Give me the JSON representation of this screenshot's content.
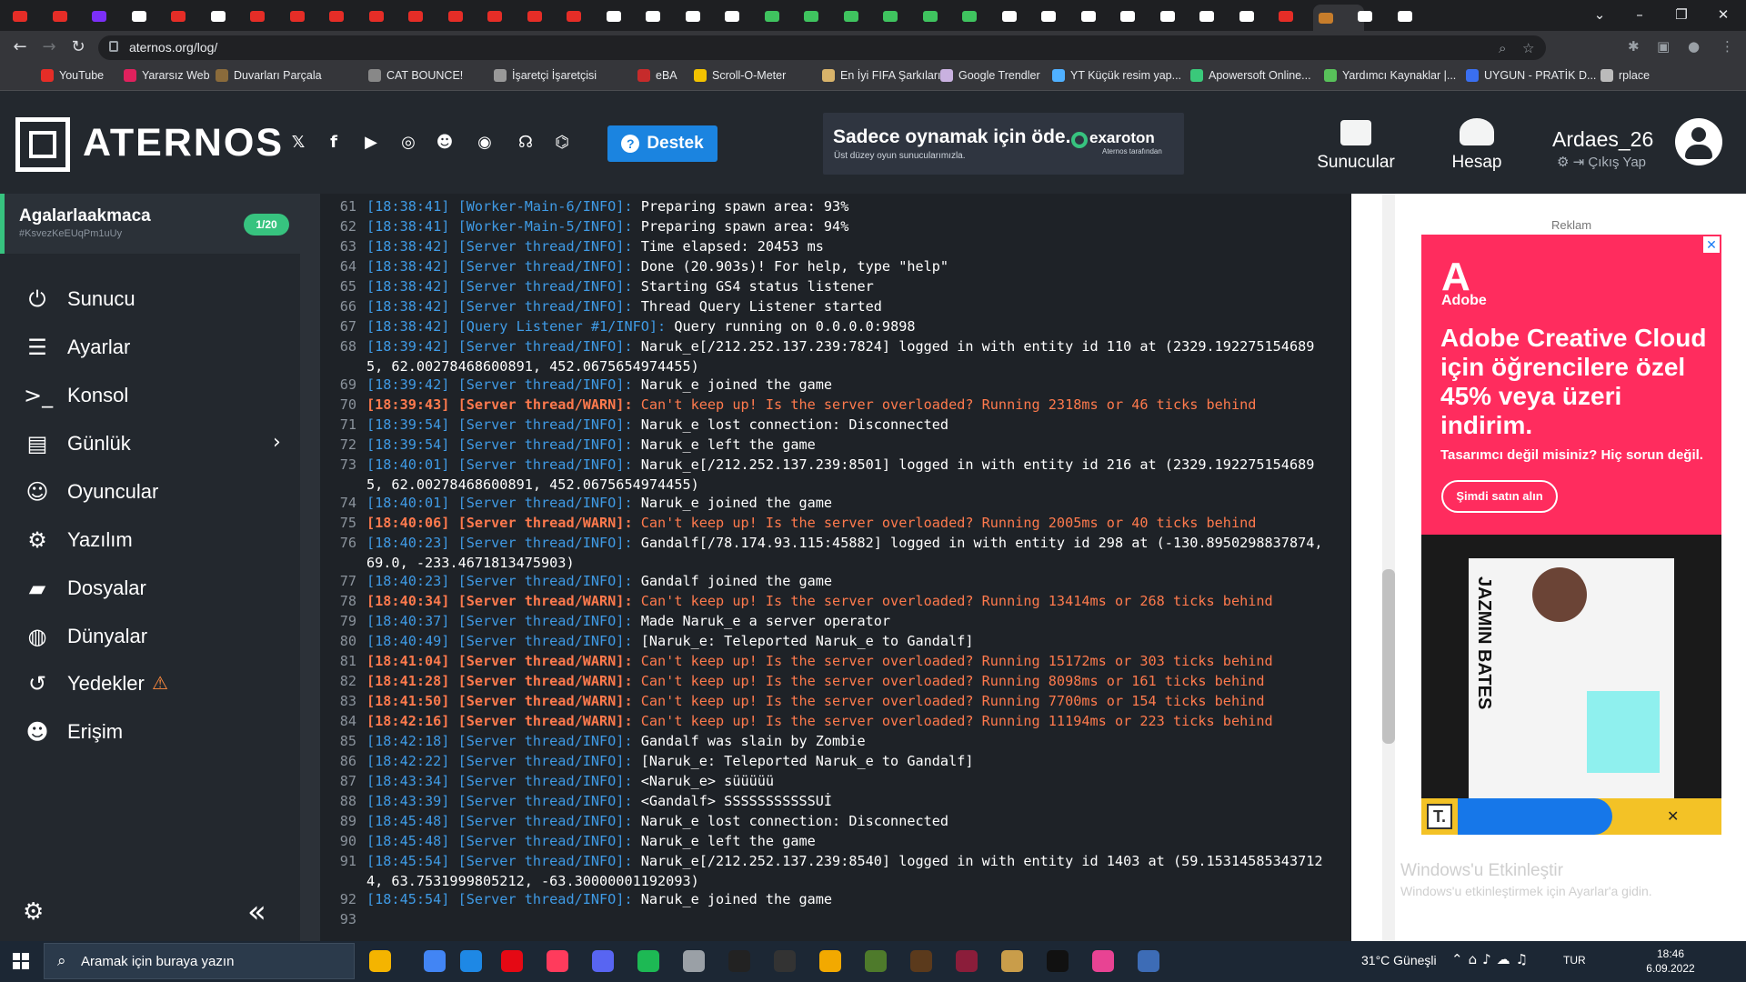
{
  "browser": {
    "url": "aternos.org/log/",
    "bookmarks": [
      "YouTube",
      "Yararsız Web",
      "Duvarları Parçala",
      "CAT BOUNCE!",
      "İşaretçi İşaretçisi",
      "eBA",
      "Scroll-O-Meter",
      "En İyi FIFA Şarkıları...",
      "Google Trendler",
      "YT Küçük resim yap...",
      "Apowersoft Online...",
      "Yardımcı Kaynaklar |...",
      "UYGUN - PRATİK D...",
      "rplace"
    ],
    "tabs_count": 36
  },
  "header": {
    "logo": "ATERNOS",
    "support_label": "Destek",
    "ad_headline": "Sadece oynamak için öde.",
    "ad_sub": "Üst düzey oyun sunucularımızla.",
    "ad_brand": "exaroton",
    "ad_brand_sub": "Aternos tarafından",
    "nav_servers": "Sunucular",
    "nav_account": "Hesap",
    "username": "Ardaes_26",
    "logout": "Çıkış Yap"
  },
  "sidebar": {
    "server_name": "Agalarlaakmaca",
    "server_id": "#KsvezKeEUqPm1uUy",
    "player_count": "1/20",
    "items": [
      {
        "label": "Sunucu"
      },
      {
        "label": "Ayarlar"
      },
      {
        "label": "Konsol"
      },
      {
        "label": "Günlük"
      },
      {
        "label": "Oyuncular"
      },
      {
        "label": "Yazılım"
      },
      {
        "label": "Dosyalar"
      },
      {
        "label": "Dünyalar"
      },
      {
        "label": "Yedekler"
      },
      {
        "label": "Erişim"
      }
    ]
  },
  "log": [
    {
      "n": "61",
      "t": "[18:38:41]",
      "s": "[Worker-Main-6/INFO]:",
      "m": "Preparing spawn area: 93%",
      "w": false
    },
    {
      "n": "62",
      "t": "[18:38:41]",
      "s": "[Worker-Main-5/INFO]:",
      "m": "Preparing spawn area: 94%",
      "w": false
    },
    {
      "n": "63",
      "t": "[18:38:42]",
      "s": "[Server thread/INFO]:",
      "m": "Time elapsed: 20453 ms",
      "w": false
    },
    {
      "n": "64",
      "t": "[18:38:42]",
      "s": "[Server thread/INFO]:",
      "m": "Done (20.903s)! For help, type \"help\"",
      "w": false
    },
    {
      "n": "65",
      "t": "[18:38:42]",
      "s": "[Server thread/INFO]:",
      "m": "Starting GS4 status listener",
      "w": false
    },
    {
      "n": "66",
      "t": "[18:38:42]",
      "s": "[Server thread/INFO]:",
      "m": "Thread Query Listener started",
      "w": false
    },
    {
      "n": "67",
      "t": "[18:38:42]",
      "s": "[Query Listener #1/INFO]:",
      "m": "Query running on 0.0.0.0:9898",
      "w": false
    },
    {
      "n": "68",
      "t": "[18:39:42]",
      "s": "[Server thread/INFO]:",
      "m": "Naruk_e[/212.252.137.239:7824] logged in with entity id 110 at (2329.192275154689",
      "m2": "5, 62.00278468600891, 452.0675654974455)",
      "w": false
    },
    {
      "n": "69",
      "t": "[18:39:42]",
      "s": "[Server thread/INFO]:",
      "m": "Naruk_e joined the game",
      "w": false
    },
    {
      "n": "70",
      "t": "[18:39:43]",
      "s": "[Server thread/WARN]:",
      "m": "Can't keep up! Is the server overloaded? Running 2318ms or 46 ticks behind",
      "w": true
    },
    {
      "n": "71",
      "t": "[18:39:54]",
      "s": "[Server thread/INFO]:",
      "m": "Naruk_e lost connection: Disconnected",
      "w": false
    },
    {
      "n": "72",
      "t": "[18:39:54]",
      "s": "[Server thread/INFO]:",
      "m": "Naruk_e left the game",
      "w": false
    },
    {
      "n": "73",
      "t": "[18:40:01]",
      "s": "[Server thread/INFO]:",
      "m": "Naruk_e[/212.252.137.239:8501] logged in with entity id 216 at (2329.192275154689",
      "m2": "5, 62.00278468600891, 452.0675654974455)",
      "w": false
    },
    {
      "n": "74",
      "t": "[18:40:01]",
      "s": "[Server thread/INFO]:",
      "m": "Naruk_e joined the game",
      "w": false
    },
    {
      "n": "75",
      "t": "[18:40:06]",
      "s": "[Server thread/WARN]:",
      "m": "Can't keep up! Is the server overloaded? Running 2005ms or 40 ticks behind",
      "w": true
    },
    {
      "n": "76",
      "t": "[18:40:23]",
      "s": "[Server thread/INFO]:",
      "m": "Gandalf[/78.174.93.115:45882] logged in with entity id 298 at (-130.8950298837874,",
      "m2": "69.0, -233.4671813475903)",
      "w": false
    },
    {
      "n": "77",
      "t": "[18:40:23]",
      "s": "[Server thread/INFO]:",
      "m": "Gandalf joined the game",
      "w": false
    },
    {
      "n": "78",
      "t": "[18:40:34]",
      "s": "[Server thread/WARN]:",
      "m": "Can't keep up! Is the server overloaded? Running 13414ms or 268 ticks behind",
      "w": true
    },
    {
      "n": "79",
      "t": "[18:40:37]",
      "s": "[Server thread/INFO]:",
      "m": "Made Naruk_e a server operator",
      "w": false
    },
    {
      "n": "80",
      "t": "[18:40:49]",
      "s": "[Server thread/INFO]:",
      "m": "[Naruk_e: Teleported Naruk_e to Gandalf]",
      "w": false
    },
    {
      "n": "81",
      "t": "[18:41:04]",
      "s": "[Server thread/WARN]:",
      "m": "Can't keep up! Is the server overloaded? Running 15172ms or 303 ticks behind",
      "w": true
    },
    {
      "n": "82",
      "t": "[18:41:28]",
      "s": "[Server thread/WARN]:",
      "m": "Can't keep up! Is the server overloaded? Running 8098ms or 161 ticks behind",
      "w": true
    },
    {
      "n": "83",
      "t": "[18:41:50]",
      "s": "[Server thread/WARN]:",
      "m": "Can't keep up! Is the server overloaded? Running 7700ms or 154 ticks behind",
      "w": true
    },
    {
      "n": "84",
      "t": "[18:42:16]",
      "s": "[Server thread/WARN]:",
      "m": "Can't keep up! Is the server overloaded? Running 11194ms or 223 ticks behind",
      "w": true
    },
    {
      "n": "85",
      "t": "[18:42:18]",
      "s": "[Server thread/INFO]:",
      "m": "Gandalf was slain by Zombie",
      "w": false
    },
    {
      "n": "86",
      "t": "[18:42:22]",
      "s": "[Server thread/INFO]:",
      "m": "[Naruk_e: Teleported Naruk_e to Gandalf]",
      "w": false
    },
    {
      "n": "87",
      "t": "[18:43:34]",
      "s": "[Server thread/INFO]:",
      "m": "<Naruk_e> süüüüü",
      "w": false
    },
    {
      "n": "88",
      "t": "[18:43:39]",
      "s": "[Server thread/INFO]:",
      "m": "<Gandalf> SSSSSSSSSSSUİ",
      "w": false
    },
    {
      "n": "89",
      "t": "[18:45:48]",
      "s": "[Server thread/INFO]:",
      "m": "Naruk_e lost connection: Disconnected",
      "w": false
    },
    {
      "n": "90",
      "t": "[18:45:48]",
      "s": "[Server thread/INFO]:",
      "m": "Naruk_e left the game",
      "w": false
    },
    {
      "n": "91",
      "t": "[18:45:54]",
      "s": "[Server thread/INFO]:",
      "m": "Naruk_e[/212.252.137.239:8540] logged in with entity id 1403 at (59.15314585343712",
      "m2": "4, 63.7531999805212, -63.30000001192093)",
      "w": false
    },
    {
      "n": "92",
      "t": "[18:45:54]",
      "s": "[Server thread/INFO]:",
      "m": "Naruk_e joined the game",
      "w": false
    },
    {
      "n": "93",
      "t": "",
      "s": "",
      "m": "",
      "w": false
    }
  ],
  "ad": {
    "label": "Reklam",
    "brand": "Adobe",
    "headline": "Adobe Creative Cloud için öğrencilere özel 45% veya üzeri indirim.",
    "sub": "Tasarımcı değil misiniz? Hiç sorun değil.",
    "cta": "Şimdi satın alın",
    "resume_name": "JAZMIN BATES"
  },
  "windows": {
    "activate_title": "Windows'u Etkinleştir",
    "activate_sub": "Windows'u etkinleştirmek için Ayarlar'a gidin."
  },
  "taskbar": {
    "search_placeholder": "Aramak için buraya yazın",
    "weather": "31°C  Güneşli",
    "lang": "TUR",
    "time": "18:46",
    "date": "6.09.2022"
  },
  "colors": {
    "accent": "#1b84e0",
    "green": "#37c37f",
    "info": "#3f9be6",
    "warn": "#ff7a4d"
  }
}
